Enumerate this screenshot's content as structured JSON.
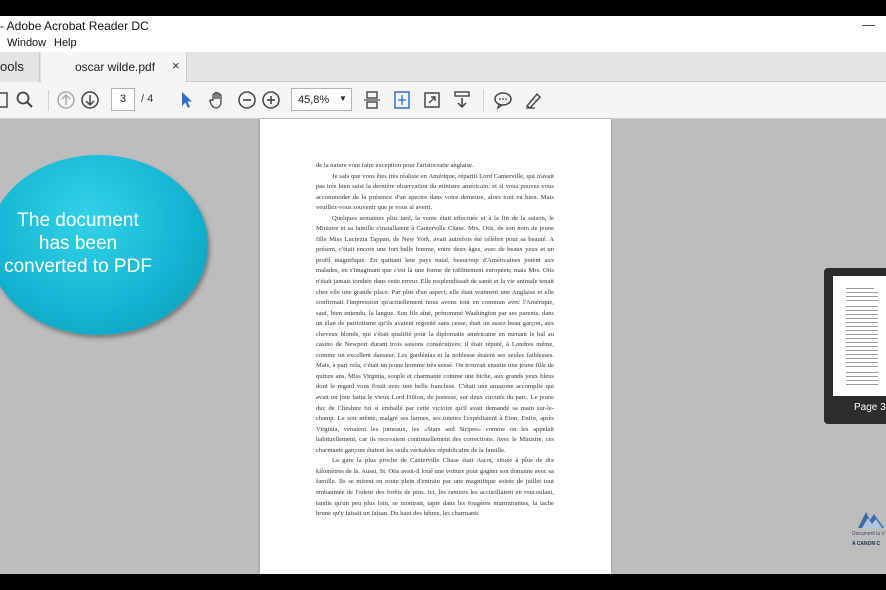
{
  "window": {
    "title": "- Adobe Acrobat Reader DC",
    "minimize_glyph": "—"
  },
  "menu": {
    "window": "Window",
    "help": "Help"
  },
  "tabs": {
    "tools_label": "ools",
    "document_label": "oscar wilde.pdf",
    "close_glyph": "×"
  },
  "toolbar": {
    "page_number": "3",
    "page_total": "/ 4",
    "zoom": "45,8%",
    "icons": [
      "save-icon",
      "search-icon",
      "page-up-icon",
      "page-down-icon",
      "select-cursor-icon",
      "hand-icon",
      "zoom-out-icon",
      "zoom-in-icon",
      "scrolling-mode-icon",
      "fit-page-icon",
      "full-screen-icon",
      "read-mode-icon",
      "comment-icon",
      "highlight-pen-icon"
    ],
    "accent_color": "#2d6fd3"
  },
  "callout": {
    "text_lines": [
      "The document",
      "has been",
      "converted to PDF"
    ],
    "color": "#14b6d3"
  },
  "thumbnail": {
    "label": "Page 3"
  },
  "watermark": {
    "line1": "Document la V",
    "line2": "A CANON C"
  },
  "document": {
    "paragraphs": [
      "de la nature vont faire exception pour l'aristocratie anglaise.",
      "Je sais que vous êtes très réaliste en Amérique, répartit Lord Canterville, qui n'avait pas très bien saisi la dernière observation du ministre américain; et si vous pouvez vous accommoder de la présence d'un spectre dans votre demeure, alors tout va bien. Mais veuillez-vous souvenir que je vous ai averti.",
      "Quelques semaines plus tard, la vente était effectuée et à la fin de la saison, le Ministre et sa famille s'installaient à Canterville Chase. Mrs. Otis, de son nom de jeune fille Miss Lucrezia Tappan, de New York, avait autrefois été célèbre pour sa beauté. A présent, c'était encore une fort belle femme, entre deux âges, avec de beaux yeux et un profil magnifique. En quittant leur pays natal, beaucoup d'Américaines jouent aux malades, en s'imaginant que c'est là une forme de raffinement européen; mais Mrs. Otis n'était jamais tombée dans cette erreur. Elle resplendissait de santé et la vie animale tenait chez elle une grande place. Par plus d'un aspect, elle était vraiment une Anglaise et elle confirmait l'impression qu'actuellement nous avons tout en commun avec l'Amérique, sauf, bien entendu, la langue. Son fils aîné, prénommé Washington par ses parents, dans un élan de patriotisme qu'ils avaient regretté sans cesse, était un assez beau garçon, aux cheveux blonds, qui s'était qualifié pour la diplomatie américaine en menant le bal au casino de Newport durant trois saisons consécutives; il était réputé, à Londres même, comme un excellent danseur. Les gardénias et la noblesse étaient ses seules faiblesses. Mais, à part cela, c'était un jeune homme très sensé. On trouvait ensuite une jeune fille de quinze ans, Miss Virginia, souple et charmante comme une biche, aux grands yeux bleus dont le regard vous fixait avec une belle franchise. C'était une amazone accomplie qui avait un jour battu le vieux Lord Hilton, de justesse, sur deux circuits du parc. Le jeune duc de Cheshire fut si emballé par cette victoire qu'il avait demandé sa main sur-le-champ. Le soir même, malgré ses larmes, ses tuteurs l'expédiaient à Eton. Enfin, après Virginia, venaient les jumeaux, les «Stars and Stripes» comme on les appelait habituellement, car ils recevaient continuellement des corrections. Avec le Ministre, ces charmants garçons étaient les seuls véritables républicains de la famille.",
      "La gare la plus proche de Canterville Chase était Ascot, située à plus de dix kilomètres de là. Aussi, St. Otis avait-il loué une voiture pour gagner son domaine avec sa famille. Ils se mirent en route plein d'entrain par une magnifique soirée de juillet tout embaumée de l'odeur des forêts de pins. Ici, les ramiers les accueillaient en roucoulant, tandis qu'un peu plus loin, se montrait, tapie dans les fougères murmurantes, la tache brune qu'y faisait un faisan. Du haut des hêtres, les charmants"
    ]
  }
}
